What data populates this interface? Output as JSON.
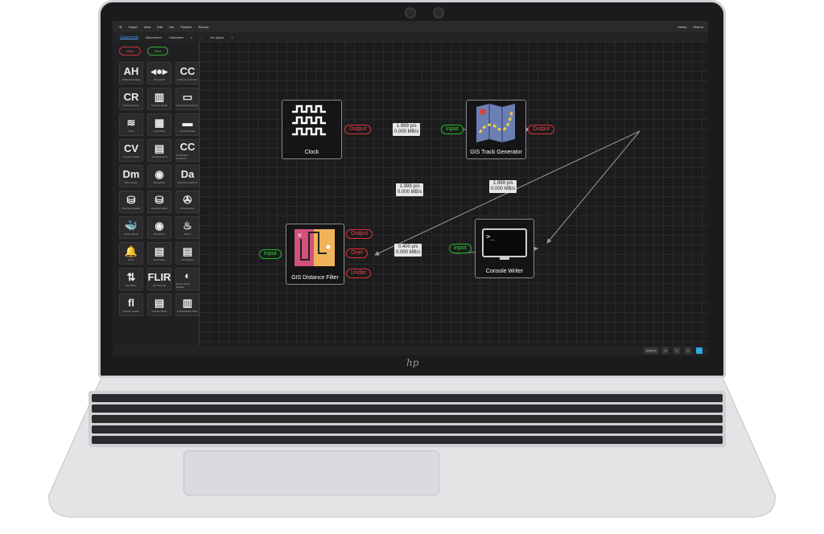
{
  "topbar": {
    "items": [
      "Graph",
      "View",
      "Edit",
      "Set",
      "Pipeline",
      "Record"
    ],
    "right": [
      "Select",
      "Search"
    ]
  },
  "tabs": [
    "Components",
    "Discovered",
    "Oldmaster",
    "No topics"
  ],
  "sidebar": {
    "chips": [
      "Initial",
      "New"
    ],
    "tiles": [
      {
        "glyph": "AH",
        "name": "Additional Header"
      },
      {
        "glyph": "◂●▸",
        "name": "Allocate IP"
      },
      {
        "glyph": "CC",
        "name": "Collapse Controller"
      },
      {
        "glyph": "CR",
        "name": "CRV Renderer"
      },
      {
        "glyph": "▥",
        "name": "Camera Model"
      },
      {
        "glyph": "▭",
        "name": "Cleanup transformer"
      },
      {
        "glyph": "≋",
        "name": "Clock"
      },
      {
        "glyph": "▦",
        "name": "Code Block"
      },
      {
        "glyph": "▬",
        "name": "Console Writer"
      },
      {
        "glyph": "CV",
        "name": "Constant Value"
      },
      {
        "glyph": "▤",
        "name": "Constant word"
      },
      {
        "glyph": "CC",
        "name": "Coordinate Combiner"
      },
      {
        "glyph": "Dm",
        "name": "Data merger"
      },
      {
        "glyph": "◉",
        "name": "Decryption"
      },
      {
        "glyph": "Da",
        "name": "Detection analyzer"
      },
      {
        "glyph": "⛁",
        "name": "Directory Reader"
      },
      {
        "glyph": "⛁",
        "name": "Directory Writer"
      },
      {
        "glyph": "✇",
        "name": "Disk Cleaner"
      },
      {
        "glyph": "🐳",
        "name": "Docker Block"
      },
      {
        "glyph": "◉",
        "name": "Encryption"
      },
      {
        "glyph": "♨",
        "name": "Event"
      },
      {
        "glyph": "🔔",
        "name": "Event"
      },
      {
        "glyph": "▤",
        "name": "Exif Parser"
      },
      {
        "glyph": "▤",
        "name": "File Reader"
      },
      {
        "glyph": "⇅",
        "name": "File Writer"
      },
      {
        "glyph": "FLIR",
        "name": "Flir Thermal"
      },
      {
        "glyph": "◐",
        "name": "Flying Drone Enabler"
      },
      {
        "glyph": "fl",
        "name": "FluxDC sender"
      },
      {
        "glyph": "▤",
        "name": "Frames Writer"
      },
      {
        "glyph": "▥",
        "name": "GIS Distance Filter"
      }
    ]
  },
  "nodes": {
    "clock": {
      "title": "Clock",
      "output": "Output"
    },
    "gis_track": {
      "title": "GIS Track Generator",
      "input": "Input",
      "output": "Output"
    },
    "gis_filter": {
      "title": "GIS Distance Filter",
      "input": "Input",
      "outputs": [
        "Output",
        "Over",
        "Under"
      ]
    },
    "console": {
      "title": "Console Writer",
      "input": "Input"
    }
  },
  "rates": {
    "clock_to_track": [
      "1.999 p/s",
      "0.000 MB/s"
    ],
    "track_to_filter": [
      "1.999 p/s",
      "0.000 MB/s"
    ],
    "track_to_console": [
      "1.999 p/s",
      "0.000 MB/s"
    ],
    "filter_to_console": [
      "0.400 p/s",
      "0.000 MB/s"
    ]
  },
  "statusbar": {
    "left_label": "localhost"
  },
  "brand": "hp",
  "colors": {
    "output_port": "#dd3333",
    "input_port": "#33bb33",
    "canvas": "#1c1c1e",
    "link": "#9a9a9a"
  }
}
